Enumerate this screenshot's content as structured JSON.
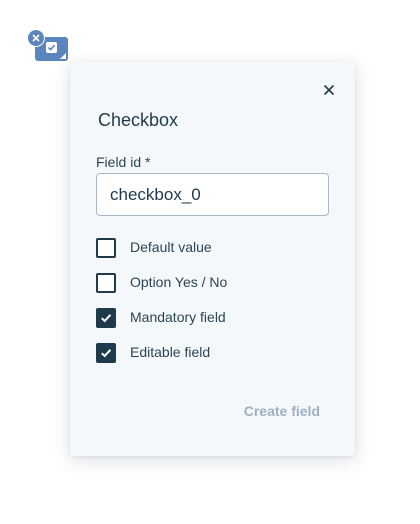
{
  "widget": {
    "type_icon": "checkbox-icon",
    "remove_icon": "close-icon"
  },
  "popover": {
    "title": "Checkbox",
    "close_icon": "close-icon",
    "field_id": {
      "label": "Field id *",
      "value": "checkbox_0"
    },
    "options": [
      {
        "label": "Default value",
        "checked": false
      },
      {
        "label": "Option Yes / No",
        "checked": false
      },
      {
        "label": "Mandatory field",
        "checked": true
      },
      {
        "label": "Editable field",
        "checked": true
      }
    ],
    "create_label": "Create field"
  },
  "colors": {
    "accent": "#5b86bd",
    "text": "#1f3a4a",
    "disabled_button": "#9db0c1",
    "panel_bg": "#f5f8fb"
  }
}
